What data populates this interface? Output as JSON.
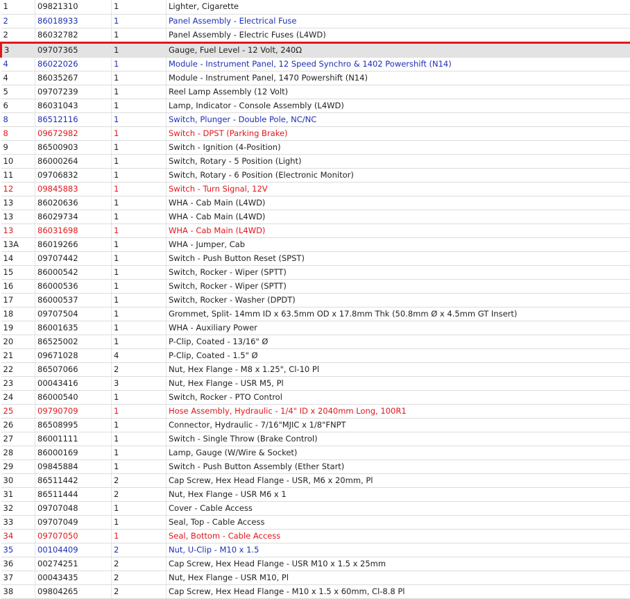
{
  "colors": {
    "blue_row": "#1d2fb5",
    "red_row": "#e0161b",
    "highlight_border": "#e3161b",
    "highlight_fill": "#e3e3e3"
  },
  "rows": [
    {
      "ref": "1",
      "part": "09821310",
      "qty": "1",
      "desc": "Lighter, Cigarette",
      "style": "normal"
    },
    {
      "ref": "2",
      "part": "86018933",
      "qty": "1",
      "desc": "Panel Assembly - Electrical Fuse",
      "style": "blue"
    },
    {
      "ref": "2",
      "part": "86032782",
      "qty": "1",
      "desc": "Panel Assembly - Electric Fuses (L4WD)",
      "style": "normal"
    },
    {
      "ref": "3",
      "part": "09707365",
      "qty": "1",
      "desc": "Gauge, Fuel Level - 12 Volt, 240Ω",
      "style": "selected"
    },
    {
      "ref": "4",
      "part": "86022026",
      "qty": "1",
      "desc": "Module - Instrument Panel, 12 Speed Synchro & 1402 Powershift (N14)",
      "style": "blue"
    },
    {
      "ref": "4",
      "part": "86035267",
      "qty": "1",
      "desc": "Module - Instrument Panel, 1470 Powershift (N14)",
      "style": "normal"
    },
    {
      "ref": "5",
      "part": "09707239",
      "qty": "1",
      "desc": "Reel Lamp Assembly (12 Volt)",
      "style": "normal"
    },
    {
      "ref": "6",
      "part": "86031043",
      "qty": "1",
      "desc": "Lamp, Indicator - Console Assembly (L4WD)",
      "style": "normal"
    },
    {
      "ref": "8",
      "part": "86512116",
      "qty": "1",
      "desc": "Switch, Plunger - Double Pole, NC/NC",
      "style": "blue"
    },
    {
      "ref": "8",
      "part": "09672982",
      "qty": "1",
      "desc": "Switch - DPST (Parking Brake)",
      "style": "red"
    },
    {
      "ref": "9",
      "part": "86500903",
      "qty": "1",
      "desc": "Switch - Ignition (4-Position)",
      "style": "normal"
    },
    {
      "ref": "10",
      "part": "86000264",
      "qty": "1",
      "desc": "Switch, Rotary - 5 Position (Light)",
      "style": "normal"
    },
    {
      "ref": "11",
      "part": "09706832",
      "qty": "1",
      "desc": "Switch, Rotary - 6 Position (Electronic Monitor)",
      "style": "normal"
    },
    {
      "ref": "12",
      "part": "09845883",
      "qty": "1",
      "desc": "Switch - Turn Signal, 12V",
      "style": "red"
    },
    {
      "ref": "13",
      "part": "86020636",
      "qty": "1",
      "desc": "WHA - Cab Main (L4WD)",
      "style": "normal"
    },
    {
      "ref": "13",
      "part": "86029734",
      "qty": "1",
      "desc": "WHA - Cab Main (L4WD)",
      "style": "normal"
    },
    {
      "ref": "13",
      "part": "86031698",
      "qty": "1",
      "desc": "WHA - Cab Main (L4WD)",
      "style": "red"
    },
    {
      "ref": "13A",
      "part": "86019266",
      "qty": "1",
      "desc": "WHA - Jumper, Cab",
      "style": "normal"
    },
    {
      "ref": "14",
      "part": "09707442",
      "qty": "1",
      "desc": "Switch - Push Button Reset (SPST)",
      "style": "normal"
    },
    {
      "ref": "15",
      "part": "86000542",
      "qty": "1",
      "desc": "Switch, Rocker - Wiper (SPTT)",
      "style": "normal"
    },
    {
      "ref": "16",
      "part": "86000536",
      "qty": "1",
      "desc": "Switch, Rocker - Wiper (SPTT)",
      "style": "normal"
    },
    {
      "ref": "17",
      "part": "86000537",
      "qty": "1",
      "desc": "Switch, Rocker - Washer (DPDT)",
      "style": "normal"
    },
    {
      "ref": "18",
      "part": "09707504",
      "qty": "1",
      "desc": "Grommet, Split- 14mm ID x 63.5mm OD x 17.8mm Thk (50.8mm Ø x 4.5mm GT Insert)",
      "style": "normal"
    },
    {
      "ref": "19",
      "part": "86001635",
      "qty": "1",
      "desc": "WHA - Auxiliary Power",
      "style": "normal"
    },
    {
      "ref": "20",
      "part": "86525002",
      "qty": "1",
      "desc": "P-Clip, Coated - 13/16\" Ø",
      "style": "normal"
    },
    {
      "ref": "21",
      "part": "09671028",
      "qty": "4",
      "desc": "P-Clip, Coated - 1.5\" Ø",
      "style": "normal"
    },
    {
      "ref": "22",
      "part": "86507066",
      "qty": "2",
      "desc": "Nut, Hex Flange - M8 x 1.25\", Cl-10 Pl",
      "style": "normal"
    },
    {
      "ref": "23",
      "part": "00043416",
      "qty": "3",
      "desc": "Nut, Hex Flange - USR M5, Pl",
      "style": "normal"
    },
    {
      "ref": "24",
      "part": "86000540",
      "qty": "1",
      "desc": "Switch, Rocker - PTO Control",
      "style": "normal"
    },
    {
      "ref": "25",
      "part": "09790709",
      "qty": "1",
      "desc": "Hose Assembly, Hydraulic - 1/4\" ID x 2040mm Long, 100R1",
      "style": "red"
    },
    {
      "ref": "26",
      "part": "86508995",
      "qty": "1",
      "desc": "Connector, Hydraulic - 7/16\"MJIC x 1/8\"FNPT",
      "style": "normal"
    },
    {
      "ref": "27",
      "part": "86001111",
      "qty": "1",
      "desc": "Switch - Single Throw (Brake Control)",
      "style": "normal"
    },
    {
      "ref": "28",
      "part": "86000169",
      "qty": "1",
      "desc": "Lamp, Gauge (W/Wire & Socket)",
      "style": "normal"
    },
    {
      "ref": "29",
      "part": "09845884",
      "qty": "1",
      "desc": "Switch - Push Button Assembly (Ether Start)",
      "style": "normal"
    },
    {
      "ref": "30",
      "part": "86511442",
      "qty": "2",
      "desc": "Cap Screw, Hex Head Flange - USR, M6 x 20mm, Pl",
      "style": "normal"
    },
    {
      "ref": "31",
      "part": "86511444",
      "qty": "2",
      "desc": "Nut, Hex Flange - USR M6 x 1",
      "style": "normal"
    },
    {
      "ref": "32",
      "part": "09707048",
      "qty": "1",
      "desc": "Cover - Cable Access",
      "style": "normal"
    },
    {
      "ref": "33",
      "part": "09707049",
      "qty": "1",
      "desc": "Seal, Top - Cable Access",
      "style": "normal"
    },
    {
      "ref": "34",
      "part": "09707050",
      "qty": "1",
      "desc": "Seal, Bottom - Cable Access",
      "style": "red"
    },
    {
      "ref": "35",
      "part": "00104409",
      "qty": "2",
      "desc": "Nut, U-Clip - M10 x 1.5",
      "style": "blue"
    },
    {
      "ref": "36",
      "part": "00274251",
      "qty": "2",
      "desc": "Cap Screw, Hex Head Flange - USR M10 x 1.5 x 25mm",
      "style": "normal"
    },
    {
      "ref": "37",
      "part": "00043435",
      "qty": "2",
      "desc": "Nut, Hex Flange - USR M10, Pl",
      "style": "normal"
    },
    {
      "ref": "38",
      "part": "09804265",
      "qty": "2",
      "desc": "Cap Screw, Hex Head Flange - M10 x 1.5 x 60mm, Cl-8.8 Pl",
      "style": "normal"
    }
  ]
}
